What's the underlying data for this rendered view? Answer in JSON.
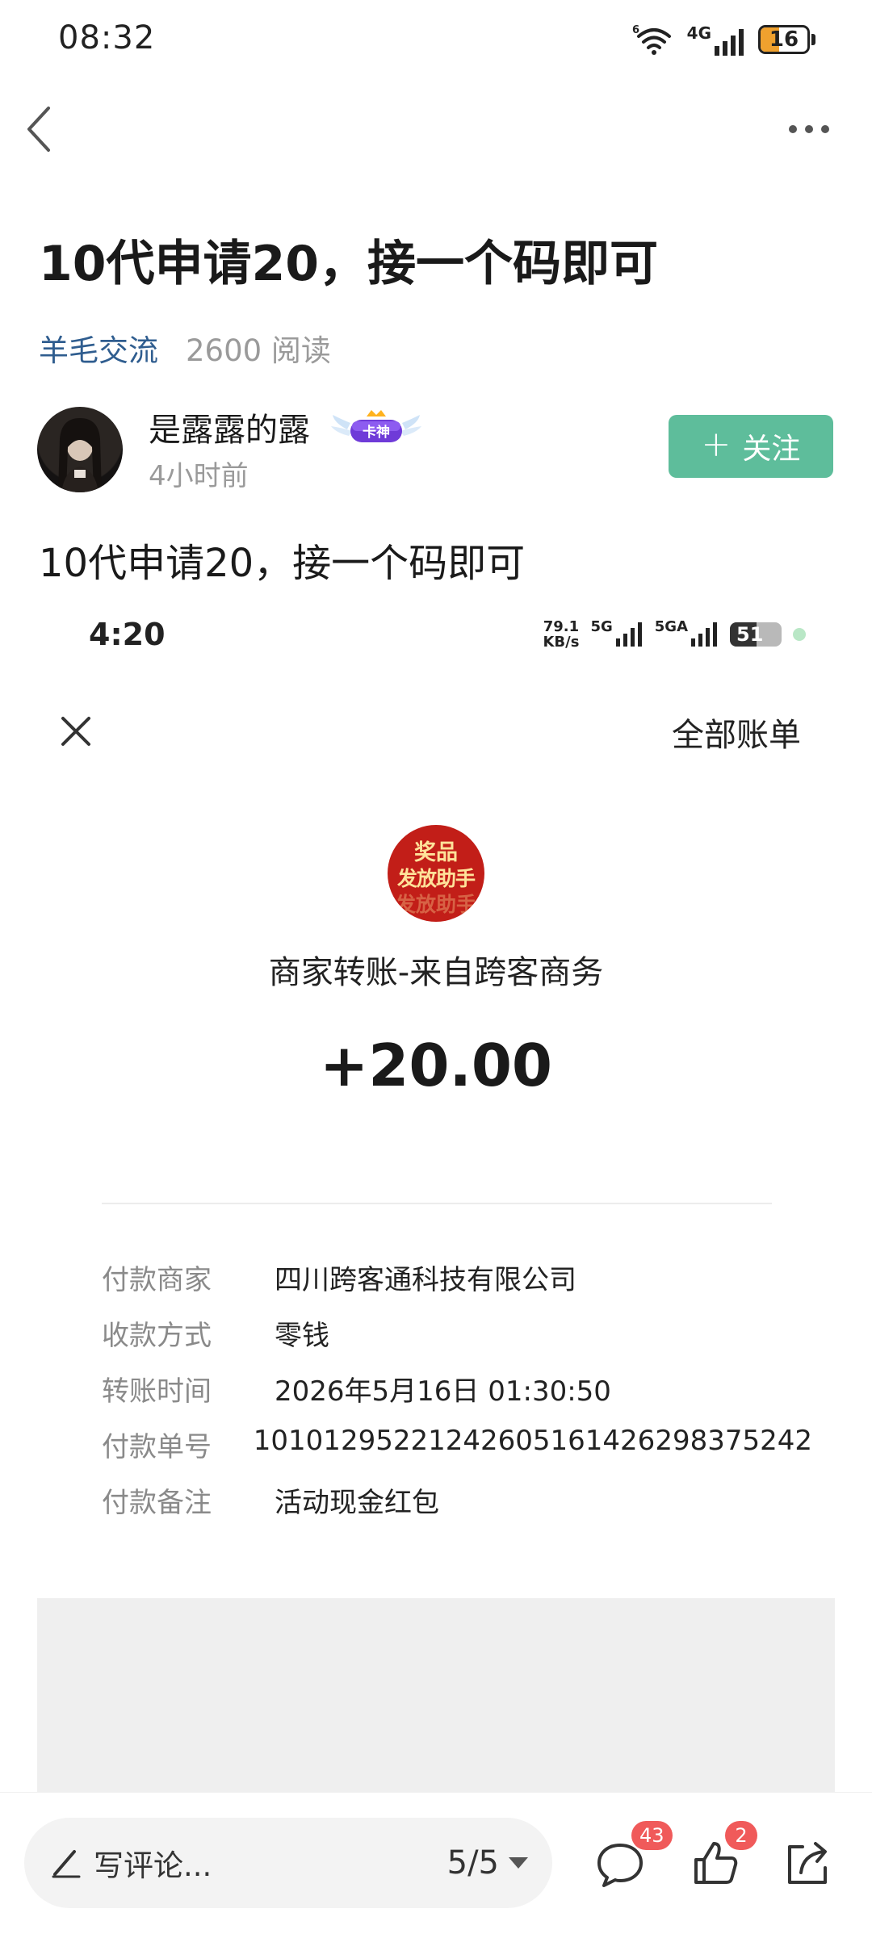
{
  "status_bar": {
    "time": "08:32",
    "network": "4G",
    "battery": "16"
  },
  "post": {
    "title": "10代申请20，接一个码即可",
    "channel": "羊毛交流",
    "views": "2600 阅读",
    "author": {
      "name": "是露露的露",
      "badge": "卡神",
      "time": "4小时前"
    },
    "follow_label": "关注",
    "body": "10代申请20，接一个码即可"
  },
  "receipt": {
    "status_bar": {
      "time": "4:20",
      "speed_value": "79.1",
      "speed_unit": "KB/s",
      "net1": "5G",
      "net2": "5GA",
      "battery": "51"
    },
    "all_bills_label": "全部账单",
    "logo_text": {
      "line1": "奖品",
      "line2": "发放助手",
      "line3": "发放助手"
    },
    "title": "商家转账-来自跨客商务",
    "amount": "+20.00",
    "details": [
      {
        "label": "付款商家",
        "value": "四川跨客通科技有限公司"
      },
      {
        "label": "收款方式",
        "value": "零钱"
      },
      {
        "label": "转账时间",
        "value": "2026年5月16日 01:30:50"
      },
      {
        "label": "付款单号",
        "value": "10101295221242605161426298375242"
      },
      {
        "label": "付款备注",
        "value": "活动现金红包"
      }
    ]
  },
  "bottom_bar": {
    "comment_placeholder": "写评论...",
    "page_indicator": "5/5",
    "comment_count": "43",
    "like_count": "2"
  },
  "colors": {
    "follow_button": "#5ebd9b",
    "channel_link": "#2f5d8f",
    "badge_red": "#f05a5a",
    "logo_red": "#c21e18"
  },
  "icons": [
    "wifi-icon",
    "signal-icon",
    "battery-icon",
    "back-arrow-icon",
    "more-dots-icon",
    "plus-icon",
    "close-icon",
    "pen-icon",
    "dropdown-icon",
    "comment-icon",
    "like-icon",
    "share-icon"
  ]
}
